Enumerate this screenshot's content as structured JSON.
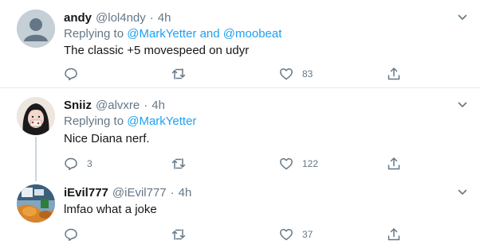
{
  "tweets": [
    {
      "name": "andy",
      "handle": "@lol4ndy",
      "dot": "·",
      "time": "4h",
      "reply_prefix": "Replying to ",
      "mentions": [
        "@MarkYetter",
        "@moobeat"
      ],
      "mention_joiner": " and ",
      "text": "The classic +5 movespeed on udyr",
      "replies": "",
      "retweets": "",
      "likes": "83"
    },
    {
      "name": "Sniiz",
      "handle": "@alvxre",
      "dot": "·",
      "time": "4h",
      "reply_prefix": "Replying to ",
      "mentions": [
        "@MarkYetter"
      ],
      "text": "Nice Diana nerf.",
      "replies": "3",
      "retweets": "",
      "likes": "122"
    },
    {
      "name": "iEvil777",
      "handle": "@iEvil777",
      "dot": "·",
      "time": "4h",
      "text": "lmfao what a joke",
      "replies": "",
      "retweets": "",
      "likes": "37"
    }
  ],
  "colors": {
    "accent": "#1da1f2",
    "secondary_text": "#657786",
    "divider": "#e6ecf0",
    "thread_line": "#ccd6dd"
  },
  "icons": {
    "reply": "reply-icon",
    "retweet": "retweet-icon",
    "like": "heart-icon",
    "share": "share-icon",
    "more": "chevron-down-icon"
  }
}
